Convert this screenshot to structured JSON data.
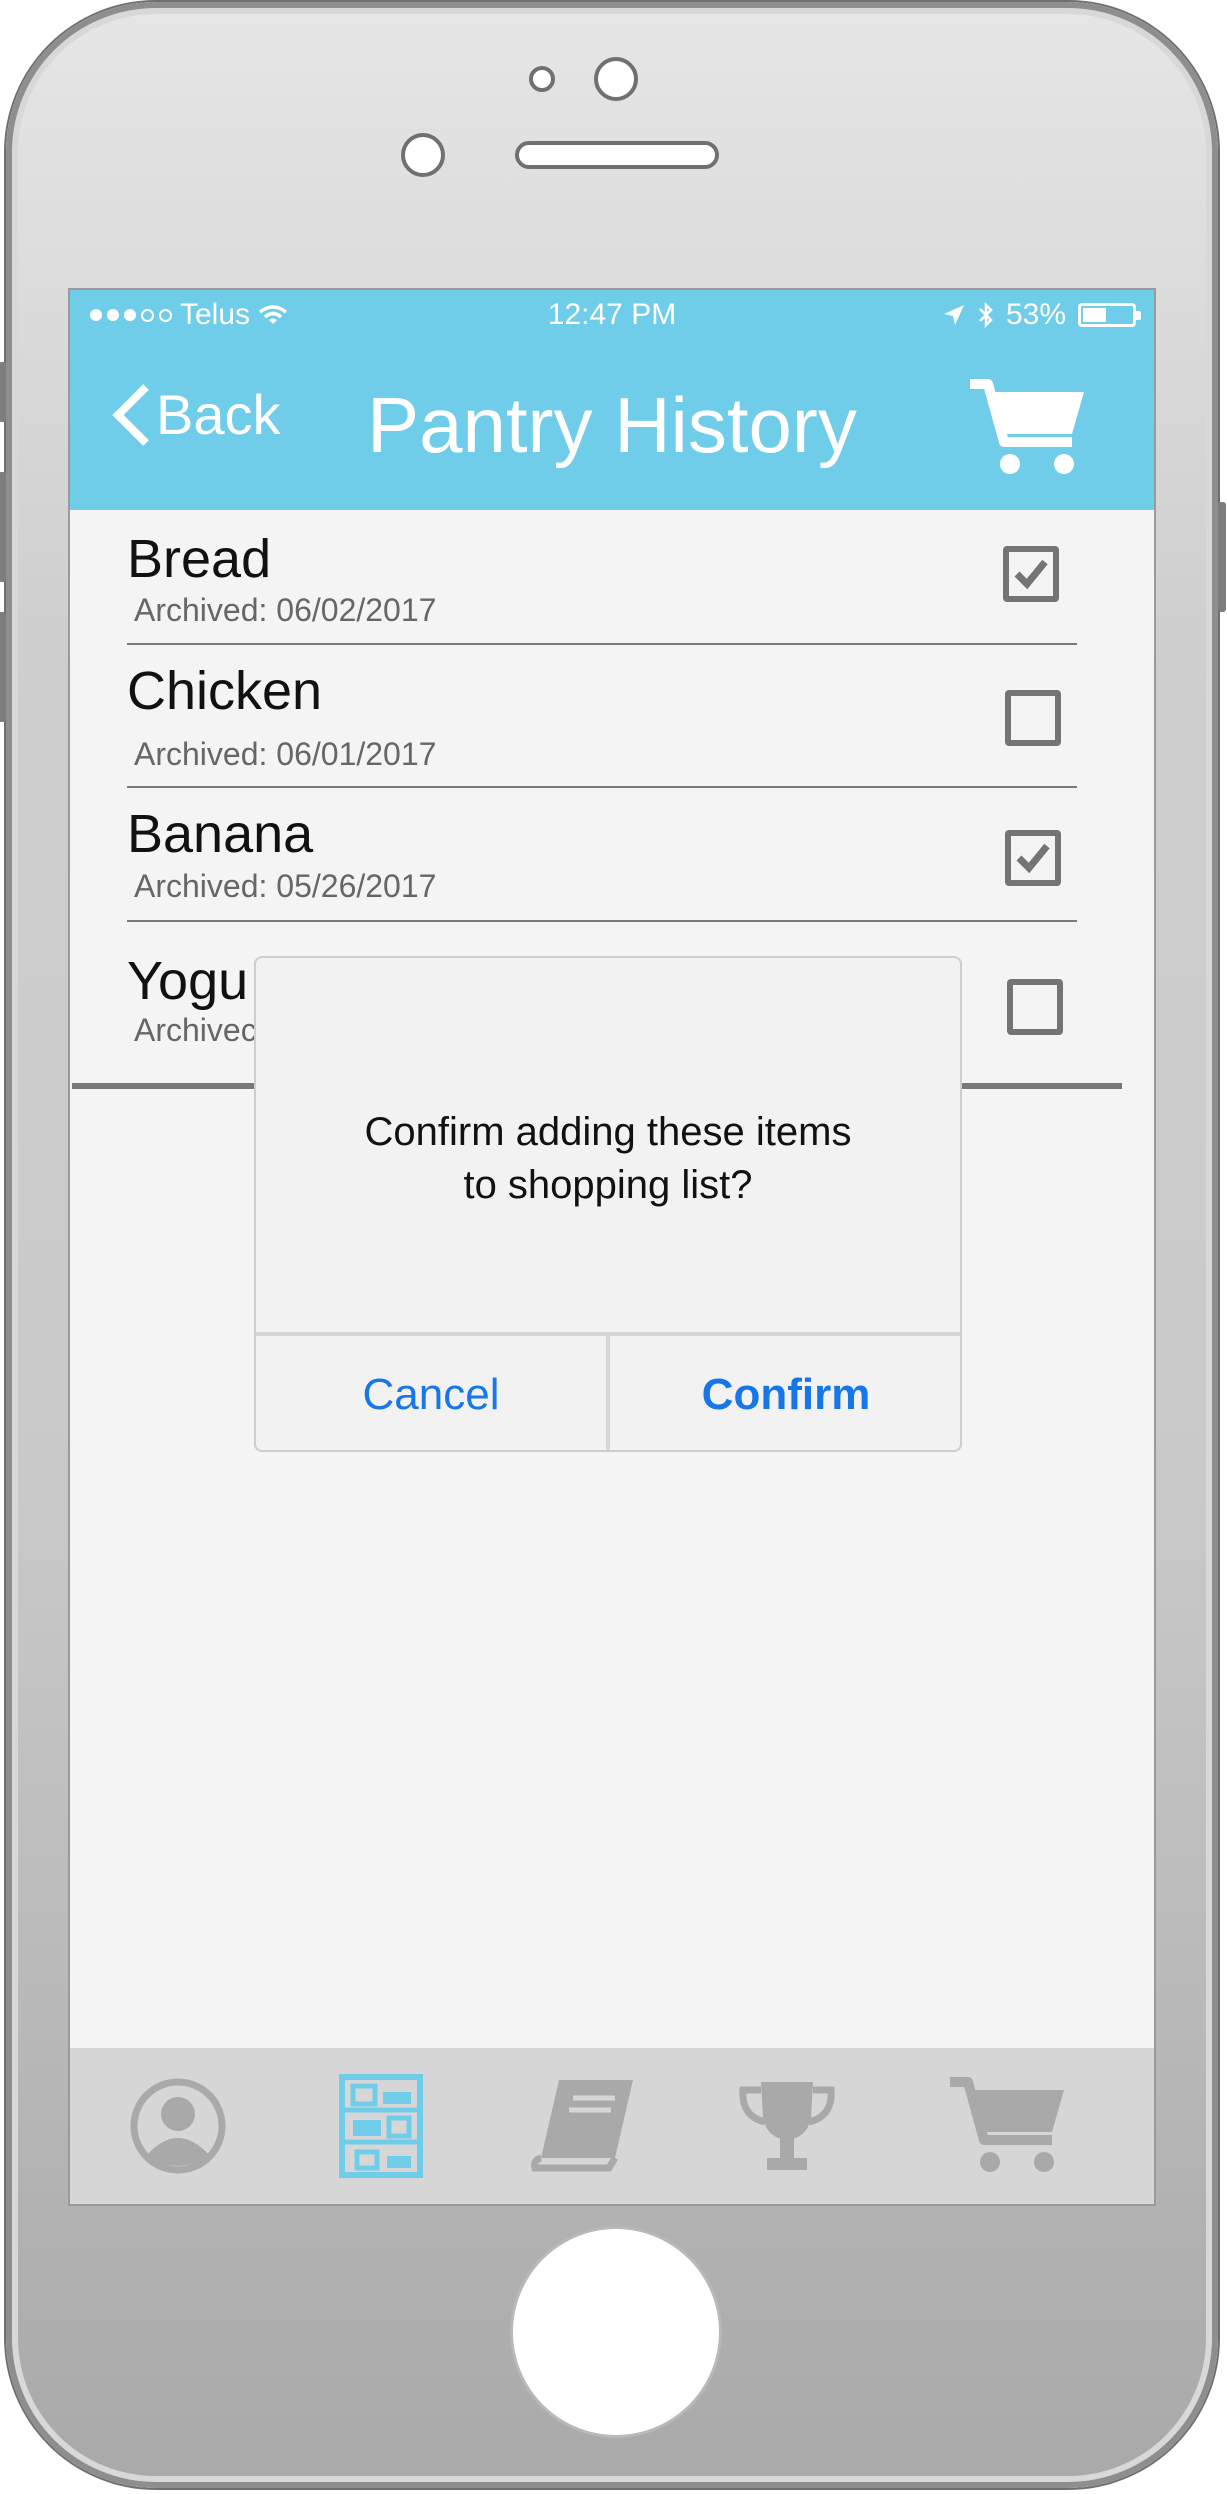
{
  "status_bar": {
    "carrier": "Telus",
    "time": "12:47 PM",
    "battery": "53%",
    "icons": [
      "signal-dots-icon",
      "wifi-icon",
      "location-arrow-icon",
      "bluetooth-icon",
      "battery-icon"
    ]
  },
  "nav": {
    "back_label": "Back",
    "title": "Pantry History",
    "cart_icon": "shopping-cart-icon"
  },
  "items": [
    {
      "name": "Bread",
      "archived": "Archived: 06/02/2017",
      "checked": true
    },
    {
      "name": "Chicken",
      "archived": "Archived: 06/01/2017",
      "checked": false
    },
    {
      "name": "Banana",
      "archived": "Archived: 05/26/2017",
      "checked": true
    },
    {
      "name": "Yogu",
      "archived": "Archivec",
      "checked": false
    }
  ],
  "dialog": {
    "message_line1": "Confirm adding these items",
    "message_line2": "to shopping list?",
    "cancel_label": "Cancel",
    "confirm_label": "Confirm"
  },
  "tab_bar": {
    "active": "pantry",
    "tabs": [
      {
        "id": "profile",
        "icon": "profile-icon"
      },
      {
        "id": "pantry",
        "icon": "pantry-shelf-icon"
      },
      {
        "id": "recipes",
        "icon": "book-icon"
      },
      {
        "id": "achievements",
        "icon": "trophy-icon"
      },
      {
        "id": "cart",
        "icon": "shopping-cart-icon"
      }
    ]
  },
  "colors": {
    "header": "#6fcdea",
    "accent_blue": "#1877e8",
    "active_tab": "#6fcdea",
    "inactive_tab": "#a9a9a9"
  }
}
